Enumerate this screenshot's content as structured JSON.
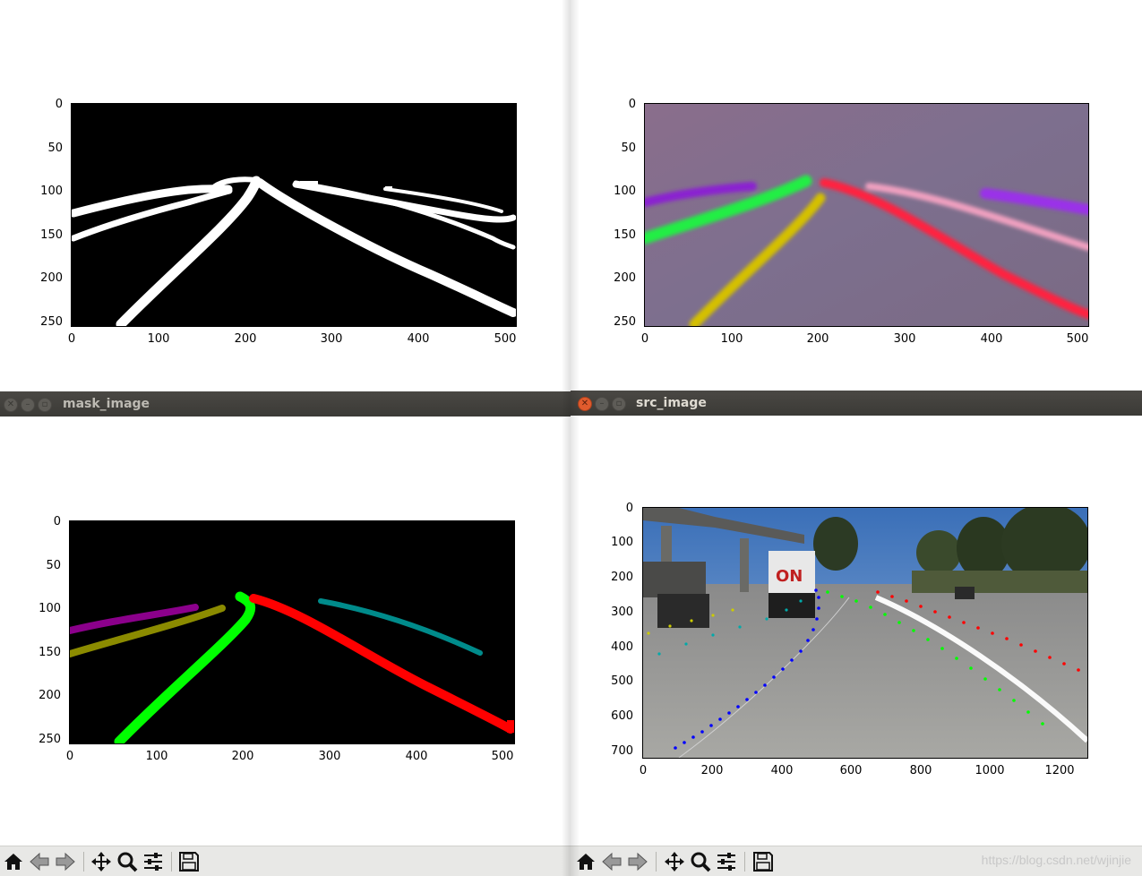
{
  "windows": {
    "mask_image": {
      "title": "mask_image"
    },
    "src_image": {
      "title": "src_image"
    }
  },
  "toolbar_buttons": [
    {
      "name": "home-icon",
      "tooltip": "Home"
    },
    {
      "name": "back-icon",
      "tooltip": "Back"
    },
    {
      "name": "forward-icon",
      "tooltip": "Forward"
    },
    {
      "name": "pan-icon",
      "tooltip": "Pan"
    },
    {
      "name": "zoom-icon",
      "tooltip": "Zoom"
    },
    {
      "name": "configure-icon",
      "tooltip": "Configure subplots"
    },
    {
      "name": "save-icon",
      "tooltip": "Save"
    }
  ],
  "watermark": "https://blog.csdn.net/wjinjie",
  "chart_data": [
    {
      "id": "binary-plot",
      "type": "image",
      "content": "binary lane segmentation (white lanes on black)",
      "xlim": [
        0,
        512
      ],
      "ylim": [
        256,
        0
      ],
      "xticks": [
        "0",
        "100",
        "200",
        "300",
        "400",
        "500"
      ],
      "yticks": [
        "0",
        "50",
        "100",
        "150",
        "200",
        "250"
      ]
    },
    {
      "id": "embedding-plot",
      "type": "image",
      "content": "instance embedding visualization",
      "xlim": [
        0,
        512
      ],
      "ylim": [
        256,
        0
      ],
      "xticks": [
        "0",
        "100",
        "200",
        "300",
        "400",
        "500"
      ],
      "yticks": [
        "0",
        "50",
        "100",
        "150",
        "200",
        "250"
      ]
    },
    {
      "id": "mask-plot",
      "type": "image",
      "content": "colored lane instance mask",
      "xlim": [
        0,
        512
      ],
      "ylim": [
        256,
        0
      ],
      "xticks": [
        "0",
        "100",
        "200",
        "300",
        "400",
        "500"
      ],
      "yticks": [
        "0",
        "50",
        "100",
        "150",
        "200",
        "250"
      ],
      "lane_colors": [
        "#8b008b",
        "#8b8b00",
        "#00ff00",
        "#ff0000",
        "#008b8b"
      ]
    },
    {
      "id": "src-plot",
      "type": "image",
      "content": "road photo with fitted lane points",
      "xlim": [
        0,
        1280
      ],
      "ylim": [
        720,
        0
      ],
      "xticks": [
        "0",
        "200",
        "400",
        "600",
        "800",
        "1000",
        "1200"
      ],
      "yticks": [
        "0",
        "100",
        "200",
        "300",
        "400",
        "500",
        "600",
        "700"
      ],
      "lane_point_colors": [
        "#0000ff",
        "#00ff00",
        "#ff0000",
        "#00aaaa",
        "#cccc00"
      ]
    }
  ]
}
